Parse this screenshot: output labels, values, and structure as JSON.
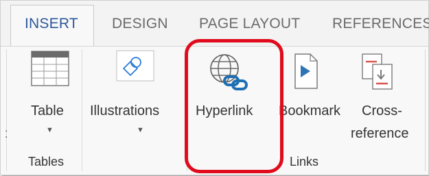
{
  "tabs": [
    {
      "label": "INSERT",
      "active": true
    },
    {
      "label": "DESIGN",
      "active": false
    },
    {
      "label": "PAGE LAYOUT",
      "active": false
    },
    {
      "label": "REFERENCES",
      "active": false
    }
  ],
  "groups": {
    "tables": {
      "label": "Tables",
      "button": "Table"
    },
    "illustrations": {
      "button": "Illustrations"
    },
    "links": {
      "label": "Links",
      "hyperlink": "Hyperlink",
      "bookmark": "Bookmark",
      "cross_reference_line1": "Cross-",
      "cross_reference_line2": "reference"
    }
  },
  "colors": {
    "accent": "#2b579a",
    "highlight": "#e00b1c",
    "link_icon": "#1e6fb3",
    "bookmark_marker": "#2e75b6",
    "crossref_red": "#d9534f"
  },
  "icons": [
    "table-icon",
    "illustrations-icon",
    "hyperlink-globe-icon",
    "bookmark-icon",
    "cross-reference-icon"
  ]
}
